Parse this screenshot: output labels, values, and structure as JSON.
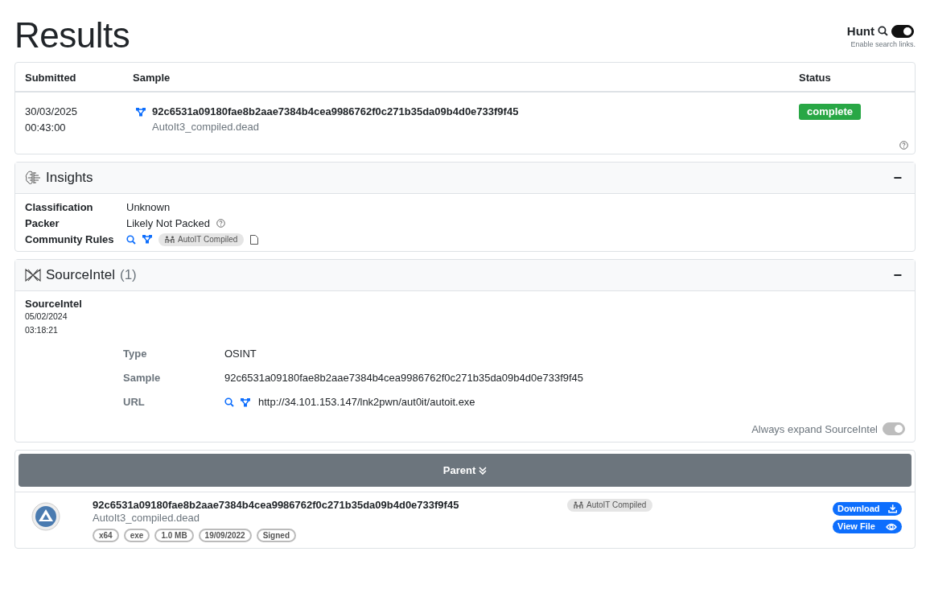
{
  "title": "Results",
  "hunt": {
    "label": "Hunt",
    "on": true,
    "hint": "Enable search links."
  },
  "results_table": {
    "columns": [
      "Submitted",
      "Sample",
      "Status"
    ],
    "rows": [
      {
        "date": "30/03/2025",
        "time": "00:43:00",
        "hash": "92c6531a09180fae8b2aae7384b4cea9986762f0c271b35da09b4d0e733f9f45",
        "filename": "AutoIt3_compiled.dead",
        "status": "complete"
      }
    ]
  },
  "insights": {
    "title": "Insights",
    "collapse": "−",
    "fields": [
      {
        "kind": "text",
        "label": "Classification",
        "value": "Unknown"
      },
      {
        "kind": "help",
        "label": "Packer",
        "value": "Likely Not Packed"
      },
      {
        "kind": "rules",
        "label": "Community Rules",
        "tag": "AutoIT Compiled"
      }
    ]
  },
  "sourceintel": {
    "title": "SourceIntel",
    "count": "(1)",
    "collapse": "−",
    "name": "SourceIntel",
    "date": "05/02/2024",
    "time": "03:18:21",
    "fields": [
      {
        "kind": "text",
        "label": "Type",
        "value": "OSINT"
      },
      {
        "kind": "text",
        "label": "Sample",
        "value": "92c6531a09180fae8b2aae7384b4cea9986762f0c271b35da09b4d0e733f9f45"
      },
      {
        "kind": "link",
        "label": "URL",
        "value": "http://34.101.153.147/lnk2pwn/aut0it/autoit.exe"
      }
    ],
    "toggle": {
      "label": "Always expand SourceIntel",
      "on": true,
      "disabled": true
    }
  },
  "parent": {
    "label": "Parent",
    "hash": "92c6531a09180fae8b2aae7384b4cea9986762f0c271b35da09b4d0e733f9f45",
    "filename": "AutoIt3_compiled.dead",
    "tags": [
      "x64",
      "exe",
      "1.0 MB",
      "19/09/2022",
      "Signed"
    ],
    "rule_tag": "AutoIT Compiled",
    "buttons": [
      {
        "kind": "download",
        "label": "Download"
      },
      {
        "kind": "view",
        "label": "View File"
      }
    ]
  }
}
